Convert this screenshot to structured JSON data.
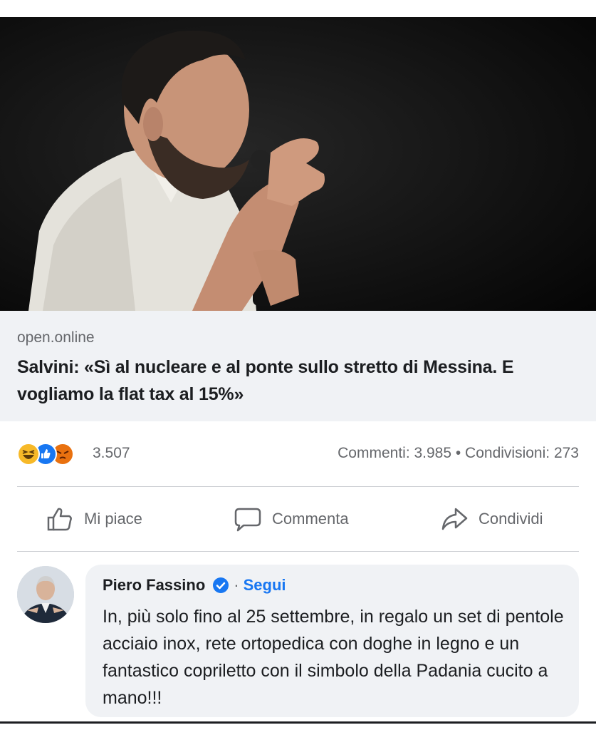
{
  "post": {
    "domain": "open.online",
    "headline": "Salvini: «Sì al nucleare e al ponte sullo stretto di Messina. E vogliamo la flat tax al 15%»"
  },
  "stats": {
    "reactions": [
      "haha",
      "like",
      "angry"
    ],
    "reaction_count": "3.507",
    "comments_shares": "Commenti: 3.985 • Condivisioni: 273"
  },
  "actions": {
    "like": "Mi piace",
    "comment": "Commenta",
    "share": "Condividi"
  },
  "comment": {
    "author": "Piero Fassino",
    "follow": "Segui",
    "text": "In, più solo fino al 25 settembre, in regalo un set di pentole acciaio inox, rete ortopedica con doghe in legno e un fantastico copriletto con il simbolo della Padania cucito a mano!!!"
  },
  "colors": {
    "accent": "#1877f2",
    "secondary_text": "#65676b",
    "bubble_bg": "#f0f2f5"
  }
}
